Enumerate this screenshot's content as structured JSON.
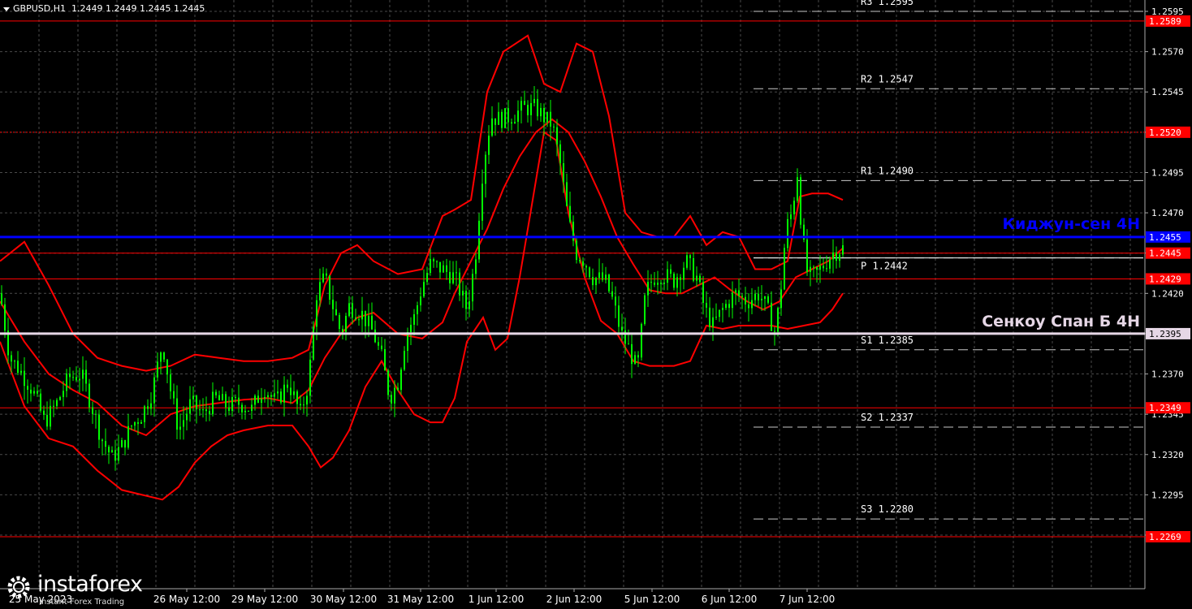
{
  "header": {
    "symbol": "GBPUSD,H1",
    "ohlc": "1.2449 1.2449 1.2445 1.2445"
  },
  "logo": {
    "name": "instaforex",
    "tagline": "Instant Forex Trading"
  },
  "colors": {
    "background": "#000000",
    "grid": "#4a4a4a",
    "candle": "#00ff00",
    "bands": "#ff0000",
    "level": "#ff0000",
    "kijun": "#0000ff",
    "senkou": "#e6d7e6",
    "pivot_label": "#ffffff"
  },
  "chart_data": {
    "type": "candlestick",
    "timeframe": "H1",
    "ylim": [
      1.2255,
      1.2605
    ],
    "y_ticks": [
      "1.2595",
      "1.2570",
      "1.2545",
      "1.2520",
      "1.2495",
      "1.2470",
      "1.2445",
      "1.2420",
      "1.2395",
      "1.2370",
      "1.2345",
      "1.2320",
      "1.2295",
      "1.2270"
    ],
    "x_ticks": [
      "25 May 2023",
      "26 May 12:00",
      "29 May 12:00",
      "30 May 12:00",
      "31 May 12:00",
      "1 Jun 12:00",
      "2 Jun 12:00",
      "5 Jun 12:00",
      "6 Jun 12:00",
      "7 Jun 12:00"
    ],
    "horizontal_levels": [
      {
        "value": 1.2589,
        "label": "1.2589",
        "style": "solid",
        "color": "#ff0000"
      },
      {
        "value": 1.252,
        "label": "1.2520",
        "style": "dotted",
        "color": "#ff0000"
      },
      {
        "value": 1.2445,
        "label": "1.2445",
        "style": "solid",
        "color": "#ff0000"
      },
      {
        "value": 1.2429,
        "label": "1.2429",
        "style": "solid",
        "color": "#ff0000"
      },
      {
        "value": 1.2349,
        "label": "1.2349",
        "style": "solid",
        "color": "#ff0000"
      },
      {
        "value": 1.2269,
        "label": "1.2269",
        "style": "solid",
        "color": "#ff0000"
      }
    ],
    "kijun": {
      "value": 1.2455,
      "label": "1.2455",
      "name": "Киджун-сен 4H",
      "color": "#0000ff"
    },
    "senkou": {
      "value": 1.2395,
      "label": "1.2395",
      "name": "Сенкоу Спан Б 4H",
      "color": "#e6d7e6"
    },
    "pivots": [
      {
        "name": "R3",
        "value": 1.2595,
        "text": "R3 1.2595"
      },
      {
        "name": "R2",
        "value": 1.2547,
        "text": "R2 1.2547"
      },
      {
        "name": "R1",
        "value": 1.249,
        "text": "R1 1.2490"
      },
      {
        "name": "P",
        "value": 1.2442,
        "text": "P 1.2442"
      },
      {
        "name": "S1",
        "value": 1.2385,
        "text": "S1 1.2385"
      },
      {
        "name": "S2",
        "value": 1.2337,
        "text": "S2 1.2337"
      },
      {
        "name": "S3",
        "value": 1.228,
        "text": "S3 1.2280"
      }
    ],
    "price_path": [
      [
        0,
        1.242
      ],
      [
        12,
        1.238
      ],
      [
        25,
        1.2372
      ],
      [
        40,
        1.236
      ],
      [
        55,
        1.234
      ],
      [
        70,
        1.2352
      ],
      [
        85,
        1.2368
      ],
      [
        100,
        1.237
      ],
      [
        112,
        1.2352
      ],
      [
        125,
        1.233
      ],
      [
        138,
        1.2318
      ],
      [
        150,
        1.2325
      ],
      [
        162,
        1.2338
      ],
      [
        175,
        1.2345
      ],
      [
        188,
        1.236
      ],
      [
        200,
        1.239
      ],
      [
        210,
        1.236
      ],
      [
        220,
        1.2335
      ],
      [
        235,
        1.2352
      ],
      [
        250,
        1.2345
      ],
      [
        265,
        1.2355
      ],
      [
        280,
        1.235
      ],
      [
        295,
        1.2352
      ],
      [
        310,
        1.2348
      ],
      [
        325,
        1.2362
      ],
      [
        340,
        1.2352
      ],
      [
        355,
        1.2365
      ],
      [
        370,
        1.2345
      ],
      [
        380,
        1.2365
      ],
      [
        390,
        1.242
      ],
      [
        400,
        1.243
      ],
      [
        410,
        1.2412
      ],
      [
        420,
        1.2395
      ],
      [
        430,
        1.2412
      ],
      [
        445,
        1.2408
      ],
      [
        460,
        1.2395
      ],
      [
        470,
        1.238
      ],
      [
        480,
        1.2355
      ],
      [
        490,
        1.2365
      ],
      [
        500,
        1.2395
      ],
      [
        510,
        1.2405
      ],
      [
        520,
        1.2425
      ],
      [
        530,
        1.2438
      ],
      [
        545,
        1.2435
      ],
      [
        560,
        1.243
      ],
      [
        575,
        1.241
      ],
      [
        585,
        1.244
      ],
      [
        595,
        1.25
      ],
      [
        605,
        1.253
      ],
      [
        615,
        1.2528
      ],
      [
        630,
        1.253
      ],
      [
        645,
        1.2535
      ],
      [
        660,
        1.2535
      ],
      [
        672,
        1.2528
      ],
      [
        680,
        1.2525
      ],
      [
        690,
        1.25
      ],
      [
        700,
        1.2465
      ],
      [
        710,
        1.2445
      ],
      [
        720,
        1.244
      ],
      [
        730,
        1.243
      ],
      [
        745,
        1.2428
      ],
      [
        755,
        1.2415
      ],
      [
        765,
        1.2395
      ],
      [
        775,
        1.2385
      ],
      [
        785,
        1.2372
      ],
      [
        795,
        1.242
      ],
      [
        805,
        1.243
      ],
      [
        815,
        1.2432
      ],
      [
        830,
        1.2428
      ],
      [
        845,
        1.244
      ],
      [
        858,
        1.243
      ],
      [
        868,
        1.241
      ],
      [
        878,
        1.24
      ],
      [
        890,
        1.241
      ],
      [
        905,
        1.242
      ],
      [
        920,
        1.2415
      ],
      [
        935,
        1.242
      ],
      [
        945,
        1.241
      ],
      [
        955,
        1.2395
      ],
      [
        962,
        1.2425
      ],
      [
        968,
        1.246
      ],
      [
        975,
        1.247
      ],
      [
        982,
        1.2495
      ],
      [
        988,
        1.2455
      ],
      [
        995,
        1.243
      ],
      [
        1005,
        1.2432
      ],
      [
        1015,
        1.2438
      ],
      [
        1025,
        1.2445
      ],
      [
        1038,
        1.2448
      ]
    ],
    "bollinger": {
      "upper": [
        [
          0,
          1.244
        ],
        [
          30,
          1.2452
        ],
        [
          60,
          1.2425
        ],
        [
          90,
          1.2395
        ],
        [
          120,
          1.238
        ],
        [
          150,
          1.2375
        ],
        [
          180,
          1.2372
        ],
        [
          210,
          1.2375
        ],
        [
          240,
          1.2382
        ],
        [
          270,
          1.238
        ],
        [
          300,
          1.2378
        ],
        [
          330,
          1.2378
        ],
        [
          360,
          1.238
        ],
        [
          380,
          1.2385
        ],
        [
          400,
          1.2425
        ],
        [
          420,
          1.2445
        ],
        [
          440,
          1.245
        ],
        [
          460,
          1.244
        ],
        [
          490,
          1.2432
        ],
        [
          520,
          1.2435
        ],
        [
          545,
          1.2468
        ],
        [
          560,
          1.2472
        ],
        [
          580,
          1.2478
        ],
        [
          600,
          1.2545
        ],
        [
          620,
          1.257
        ],
        [
          650,
          1.258
        ],
        [
          670,
          1.255
        ],
        [
          690,
          1.2545
        ],
        [
          710,
          1.2575
        ],
        [
          730,
          1.257
        ],
        [
          750,
          1.253
        ],
        [
          770,
          1.247
        ],
        [
          790,
          1.2458
        ],
        [
          810,
          1.2455
        ],
        [
          830,
          1.2455
        ],
        [
          850,
          1.2468
        ],
        [
          870,
          1.245
        ],
        [
          890,
          1.2458
        ],
        [
          910,
          1.2455
        ],
        [
          930,
          1.2435
        ],
        [
          950,
          1.2435
        ],
        [
          970,
          1.244
        ],
        [
          985,
          1.248
        ],
        [
          1000,
          1.2482
        ],
        [
          1020,
          1.2482
        ],
        [
          1038,
          1.2478
        ]
      ],
      "middle": [
        [
          0,
          1.2415
        ],
        [
          30,
          1.239
        ],
        [
          60,
          1.237
        ],
        [
          90,
          1.236
        ],
        [
          120,
          1.2352
        ],
        [
          150,
          1.2338
        ],
        [
          180,
          1.2332
        ],
        [
          210,
          1.2345
        ],
        [
          240,
          1.235
        ],
        [
          270,
          1.2352
        ],
        [
          300,
          1.2354
        ],
        [
          330,
          1.2355
        ],
        [
          360,
          1.2352
        ],
        [
          380,
          1.236
        ],
        [
          400,
          1.238
        ],
        [
          420,
          1.2395
        ],
        [
          440,
          1.2405
        ],
        [
          460,
          1.2408
        ],
        [
          490,
          1.2395
        ],
        [
          520,
          1.2392
        ],
        [
          545,
          1.2402
        ],
        [
          560,
          1.242
        ],
        [
          580,
          1.244
        ],
        [
          600,
          1.246
        ],
        [
          620,
          1.2485
        ],
        [
          640,
          1.2505
        ],
        [
          660,
          1.252
        ],
        [
          680,
          1.2528
        ],
        [
          700,
          1.252
        ],
        [
          720,
          1.2502
        ],
        [
          740,
          1.248
        ],
        [
          760,
          1.2455
        ],
        [
          780,
          1.2438
        ],
        [
          800,
          1.2422
        ],
        [
          820,
          1.242
        ],
        [
          840,
          1.242
        ],
        [
          860,
          1.2425
        ],
        [
          880,
          1.243
        ],
        [
          900,
          1.2422
        ],
        [
          920,
          1.2415
        ],
        [
          940,
          1.241
        ],
        [
          960,
          1.2415
        ],
        [
          980,
          1.243
        ],
        [
          1000,
          1.2435
        ],
        [
          1020,
          1.244
        ],
        [
          1038,
          1.2448
        ]
      ],
      "lower": [
        [
          0,
          1.239
        ],
        [
          30,
          1.235
        ],
        [
          60,
          1.233
        ],
        [
          90,
          1.2325
        ],
        [
          120,
          1.231
        ],
        [
          150,
          1.2298
        ],
        [
          175,
          1.2295
        ],
        [
          200,
          1.2292
        ],
        [
          220,
          1.23
        ],
        [
          240,
          1.2315
        ],
        [
          260,
          1.2325
        ],
        [
          280,
          1.2332
        ],
        [
          300,
          1.2335
        ],
        [
          330,
          1.2338
        ],
        [
          360,
          1.2338
        ],
        [
          380,
          1.2325
        ],
        [
          395,
          1.2312
        ],
        [
          410,
          1.2318
        ],
        [
          430,
          1.2335
        ],
        [
          450,
          1.2362
        ],
        [
          470,
          1.2378
        ],
        [
          490,
          1.236
        ],
        [
          510,
          1.2345
        ],
        [
          530,
          1.234
        ],
        [
          545,
          1.234
        ],
        [
          560,
          1.2355
        ],
        [
          575,
          1.239
        ],
        [
          595,
          1.2405
        ],
        [
          610,
          1.2385
        ],
        [
          625,
          1.2392
        ],
        [
          640,
          1.243
        ],
        [
          655,
          1.2475
        ],
        [
          670,
          1.252
        ],
        [
          685,
          1.2515
        ],
        [
          700,
          1.247
        ],
        [
          720,
          1.243
        ],
        [
          740,
          1.2403
        ],
        [
          760,
          1.2395
        ],
        [
          780,
          1.2378
        ],
        [
          800,
          1.2375
        ],
        [
          830,
          1.2375
        ],
        [
          850,
          1.2378
        ],
        [
          870,
          1.24
        ],
        [
          890,
          1.2398
        ],
        [
          910,
          1.24
        ],
        [
          930,
          1.24
        ],
        [
          950,
          1.24
        ],
        [
          970,
          1.2398
        ],
        [
          990,
          1.24
        ],
        [
          1010,
          1.2402
        ],
        [
          1025,
          1.241
        ],
        [
          1038,
          1.242
        ]
      ]
    }
  }
}
